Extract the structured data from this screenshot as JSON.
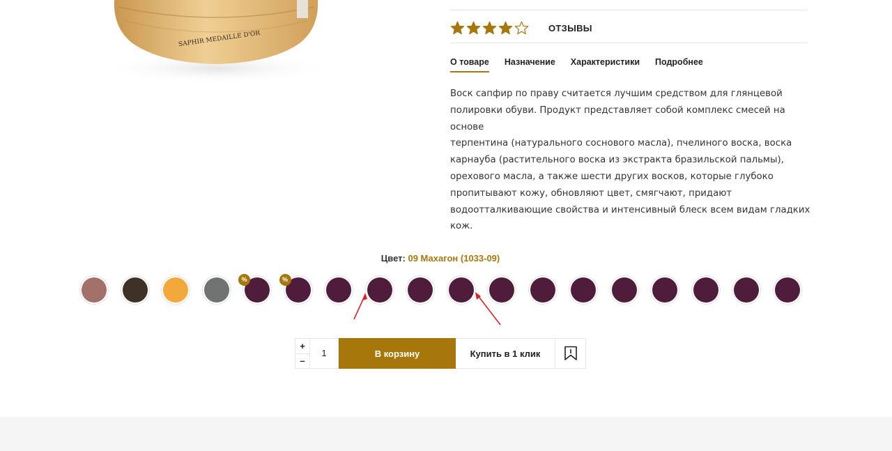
{
  "product": {
    "image_alt": "Воск сапфир в деревянной банке",
    "image_lettering": "SAPHIR MEDAILLE D'OR"
  },
  "rating": {
    "stars_filled": 4,
    "stars_total": 5,
    "reviews_label": "ОТЗЫВЫ"
  },
  "tabs": [
    {
      "label": "О товаре",
      "active": true
    },
    {
      "label": "Назначение",
      "active": false
    },
    {
      "label": "Характеристики",
      "active": false
    },
    {
      "label": "Подробнее",
      "active": false
    }
  ],
  "description": {
    "lines": [
      "Воск сапфир по праву считается лучшим средством для глянцевой",
      "полировки обуви. Продукт представляет собой комплекс смесей на основе",
      "терпентина (натурального соснового масла), пчелиного воска, воска",
      "карнауба (растительного воска из экстракта бразильской пальмы),",
      "орехового масла, а также шести других восков, которые глубоко",
      "пропитывают кожу, обновляют цвет, смягчают, придают",
      "водоотталкивающие свойства и интенсивный блеск всем видам гладких",
      "кож."
    ]
  },
  "color": {
    "label": "Цвет:",
    "selected_value": "09 Махагон (1033-09)",
    "swatches": [
      {
        "color": "#a3706a",
        "badge": ""
      },
      {
        "color": "#3e3228",
        "badge": ""
      },
      {
        "color": "#f2a83a",
        "badge": ""
      },
      {
        "color": "#717272",
        "badge": ""
      },
      {
        "color": "#4f1c3c",
        "badge": "%"
      },
      {
        "color": "#4f1c3c",
        "badge": "%"
      },
      {
        "color": "#4f1c3c",
        "badge": ""
      },
      {
        "color": "#4f1c3c",
        "badge": ""
      },
      {
        "color": "#4f1c3c",
        "badge": ""
      },
      {
        "color": "#4f1c3c",
        "badge": ""
      },
      {
        "color": "#4f1c3c",
        "badge": ""
      },
      {
        "color": "#4f1c3c",
        "badge": ""
      },
      {
        "color": "#4f1c3c",
        "badge": ""
      },
      {
        "color": "#4f1c3c",
        "badge": ""
      },
      {
        "color": "#4f1c3c",
        "badge": ""
      },
      {
        "color": "#4f1c3c",
        "badge": ""
      },
      {
        "color": "#4f1c3c",
        "badge": ""
      },
      {
        "color": "#4f1c3c",
        "badge": ""
      }
    ]
  },
  "buy": {
    "plus_label": "+",
    "minus_label": "–",
    "quantity": "1",
    "cart_label": "В корзину",
    "one_click_label": "Купить в 1 клик"
  },
  "colors": {
    "accent": "#a8770b",
    "annotation_arrow": "#d8222b",
    "footer_band": "#f5f5f5"
  }
}
